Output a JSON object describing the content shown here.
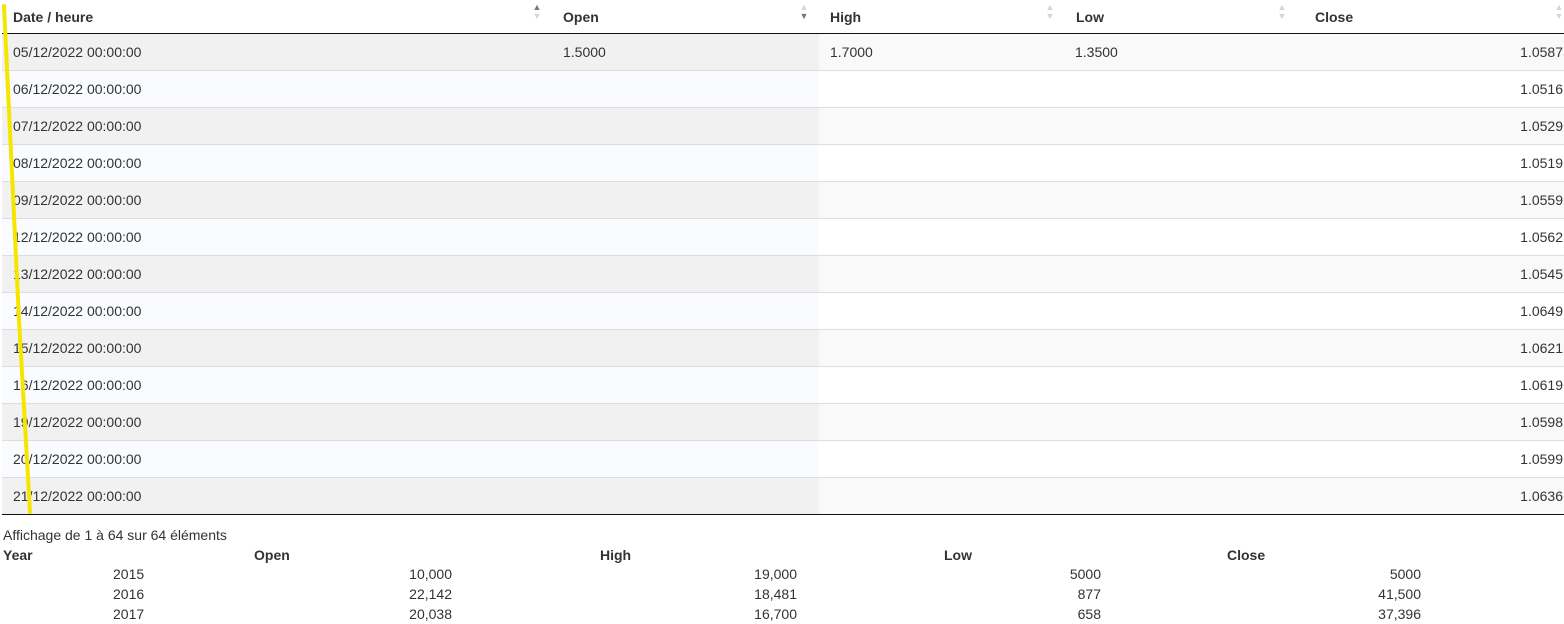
{
  "grid": {
    "headers": {
      "date": "Date / heure",
      "open": "Open",
      "high": "High",
      "low": "Low",
      "close": "Close"
    },
    "sort_icons": {
      "up": "▲",
      "down": "▼"
    },
    "rows": [
      {
        "date": "05/12/2022 00:00:00",
        "open": "1.5000",
        "high": "1.7000",
        "low": "1.3500",
        "close": "1.0587"
      },
      {
        "date": "06/12/2022 00:00:00",
        "open": "",
        "high": "",
        "low": "",
        "close": "1.0516"
      },
      {
        "date": "07/12/2022 00:00:00",
        "open": "",
        "high": "",
        "low": "",
        "close": "1.0529"
      },
      {
        "date": "08/12/2022 00:00:00",
        "open": "",
        "high": "",
        "low": "",
        "close": "1.0519"
      },
      {
        "date": "09/12/2022 00:00:00",
        "open": "",
        "high": "",
        "low": "",
        "close": "1.0559"
      },
      {
        "date": "12/12/2022 00:00:00",
        "open": "",
        "high": "",
        "low": "",
        "close": "1.0562"
      },
      {
        "date": "13/12/2022 00:00:00",
        "open": "",
        "high": "",
        "low": "",
        "close": "1.0545"
      },
      {
        "date": "14/12/2022 00:00:00",
        "open": "",
        "high": "",
        "low": "",
        "close": "1.0649"
      },
      {
        "date": "15/12/2022 00:00:00",
        "open": "",
        "high": "",
        "low": "",
        "close": "1.0621"
      },
      {
        "date": "16/12/2022 00:00:00",
        "open": "",
        "high": "",
        "low": "",
        "close": "1.0619"
      },
      {
        "date": "19/12/2022 00:00:00",
        "open": "",
        "high": "",
        "low": "",
        "close": "1.0598"
      },
      {
        "date": "20/12/2022 00:00:00",
        "open": "",
        "high": "",
        "low": "",
        "close": "1.0599"
      },
      {
        "date": "21/12/2022 00:00:00",
        "open": "",
        "high": "",
        "low": "",
        "close": "1.0636"
      }
    ]
  },
  "info_text": "Affichage de 1 à 64 sur 64 éléments",
  "summary": {
    "headers": {
      "year": "Year",
      "open": "Open",
      "high": "High",
      "low": "Low",
      "close": "Close"
    },
    "rows": [
      {
        "year": "2015",
        "open": "10,000",
        "high": "19,000",
        "low": "5000",
        "close": "5000"
      },
      {
        "year": "2016",
        "open": "22,142",
        "high": "18,481",
        "low": "877",
        "close": "41,500"
      },
      {
        "year": "2017",
        "open": "20,038",
        "high": "16,700",
        "low": "658",
        "close": "37,396"
      }
    ]
  },
  "colors": {
    "annotation_stroke": "#f5e600"
  }
}
